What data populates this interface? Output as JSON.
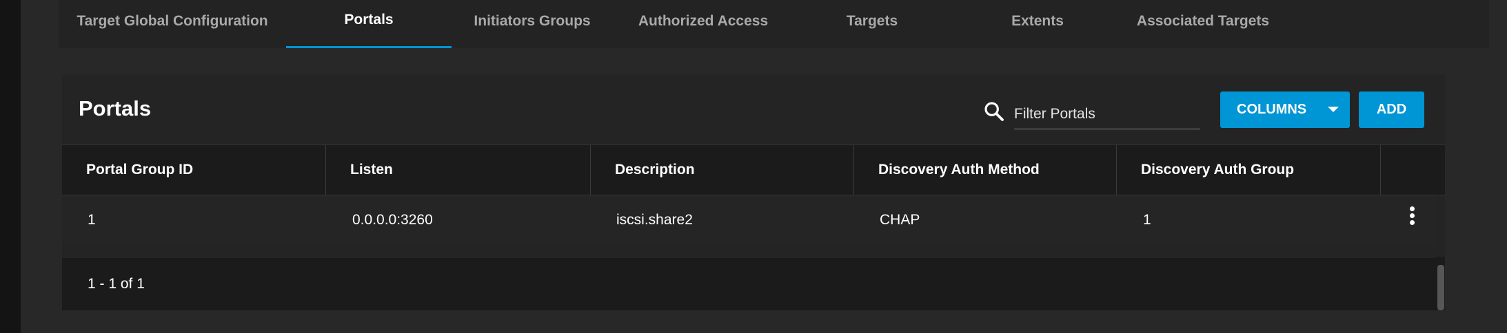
{
  "tabs": [
    {
      "label": "Target Global Configuration"
    },
    {
      "label": "Portals",
      "active": true
    },
    {
      "label": "Initiators Groups"
    },
    {
      "label": "Authorized Access"
    },
    {
      "label": "Targets"
    },
    {
      "label": "Extents"
    },
    {
      "label": "Associated Targets"
    }
  ],
  "card": {
    "title": "Portals",
    "search": {
      "placeholder": "Filter Portals",
      "value": ""
    },
    "columns_button": "COLUMNS",
    "add_button": "ADD"
  },
  "table": {
    "headers": [
      "Portal Group ID",
      "Listen",
      "Description",
      "Discovery Auth Method",
      "Discovery Auth Group"
    ],
    "rows": [
      [
        "1",
        "0.0.0.0:3260",
        "iscsi.share2",
        "CHAP",
        "1"
      ]
    ]
  },
  "pager": {
    "range_text": "1 - 1 of 1"
  },
  "colors": {
    "accent": "#0095d5",
    "background": "#242424",
    "header": "#1b1b1b"
  },
  "icons": {
    "search": "search-icon",
    "row_menu": "more-vertical-icon",
    "dropdown": "caret-down-icon"
  }
}
